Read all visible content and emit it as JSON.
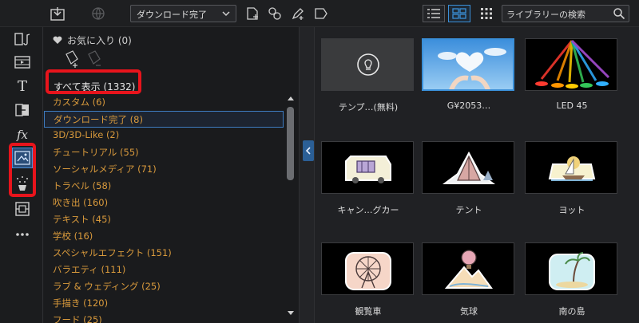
{
  "toolbar": {
    "import_icon": "import-icon",
    "dropdown_value": "ダウンロード完了",
    "search_placeholder": "ライブラリーの検索"
  },
  "rail": {
    "items": [
      "media-icon",
      "video-icon",
      "title-icon",
      "transition-icon",
      "fx-icon",
      "particle-icon",
      "sparkle-icon",
      "pip-icon",
      "more-icon"
    ]
  },
  "panel": {
    "favorites": "お気に入り (0)",
    "show_all": "すべて表示 (1332)",
    "categories": [
      "カスタム (6)",
      "ダウンロード完了 (8)",
      "3D/3D-Like (2)",
      "チュートリアル (55)",
      "ソーシャルメディア (71)",
      "トラベル (58)",
      "吹き出 (160)",
      "テキスト (45)",
      "学校 (16)",
      "スペシャルエフェクト (151)",
      "バラエティ (111)",
      "ラブ & ウェディング (25)",
      "手描き (120)",
      "フード (25)"
    ]
  },
  "grid": {
    "items": [
      {
        "caption": "テンプ…(無料)"
      },
      {
        "caption": "G¥2053…"
      },
      {
        "caption": "LED 45"
      },
      {
        "caption": "キャン…グカー"
      },
      {
        "caption": "テント"
      },
      {
        "caption": "ヨット"
      },
      {
        "caption": "観覧車"
      },
      {
        "caption": "気球"
      },
      {
        "caption": "南の島"
      }
    ]
  },
  "colors": {
    "accent": "#3a8fd8",
    "highlight_red": "#e8141c",
    "category_text": "#d99a3c"
  }
}
